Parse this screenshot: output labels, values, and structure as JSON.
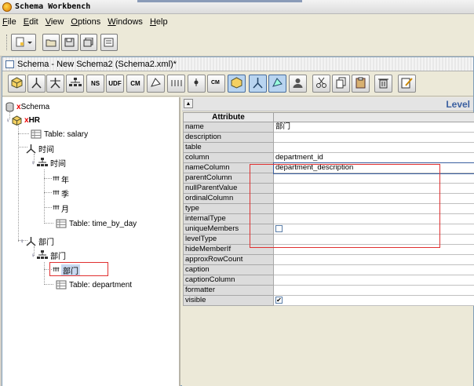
{
  "window": {
    "title": "Schema Workbench"
  },
  "menu": [
    {
      "label": "File",
      "key": "F"
    },
    {
      "label": "Edit",
      "key": "E"
    },
    {
      "label": "View",
      "key": "V"
    },
    {
      "label": "Options",
      "key": "O"
    },
    {
      "label": "Windows",
      "key": "W"
    },
    {
      "label": "Help",
      "key": "H"
    }
  ],
  "schema_window": {
    "title": "Schema - New Schema2 (Schema2.xml)*"
  },
  "schema_toolbar": [
    {
      "name": "add-cube-button",
      "icon": "cube-icon"
    },
    {
      "name": "add-dimension-button",
      "icon": "dimension-icon"
    },
    {
      "name": "add-dimension-usage-button",
      "icon": "dimension-usage-icon"
    },
    {
      "name": "add-hierarchy-button",
      "icon": "hierarchy-icon"
    },
    {
      "name": "add-named-set-button",
      "label": "NS"
    },
    {
      "name": "add-udf-button",
      "label": "UDF"
    },
    {
      "name": "add-calculated-member-button",
      "label": "CM"
    },
    {
      "name": "add-measure-button",
      "icon": "measure-icon"
    },
    {
      "name": "add-level-button",
      "icon": "level-icon"
    },
    {
      "name": "add-property-button",
      "icon": "property-icon"
    },
    {
      "name": "add-calc-member-prop-button",
      "icon": "calc-icon"
    },
    {
      "name": "add-virtual-cube-button",
      "icon": "virtual-cube-icon"
    },
    {
      "name": "add-virtual-dimension-button",
      "icon": "virtual-dimension-icon"
    },
    {
      "name": "add-virtual-measure-button",
      "icon": "virtual-measure-icon"
    },
    {
      "name": "add-role-button",
      "icon": "role-icon"
    },
    {
      "name": "cut-button",
      "icon": "scissors-icon"
    },
    {
      "name": "copy-button",
      "icon": "copy-icon"
    },
    {
      "name": "paste-button",
      "icon": "clipboard-icon"
    },
    {
      "name": "delete-button",
      "icon": "trash-icon"
    },
    {
      "name": "edit-mode-button",
      "icon": "pencil-icon"
    }
  ],
  "tree": {
    "root": "Schema",
    "cube": "HR",
    "cube_table": "Table: salary",
    "dim_time": "时间",
    "hier_time": "时间",
    "time_levels": [
      "年",
      "季",
      "月"
    ],
    "time_table": "Table: time_by_day",
    "dim_dept": "部门",
    "hier_dept": "部门",
    "dept_level": "部门",
    "dept_table": "Table: department"
  },
  "attributes": {
    "level_label": "Level",
    "header": "Attribute",
    "rows": [
      {
        "name": "name",
        "value": "部门"
      },
      {
        "name": "description",
        "value": ""
      },
      {
        "name": "table",
        "value": ""
      },
      {
        "name": "column",
        "value": "department_id"
      },
      {
        "name": "nameColumn",
        "value": "department_description"
      },
      {
        "name": "parentColumn",
        "value": ""
      },
      {
        "name": "nullParentValue",
        "value": ""
      },
      {
        "name": "ordinalColumn",
        "value": ""
      },
      {
        "name": "type",
        "value": ""
      },
      {
        "name": "internalType",
        "value": ""
      },
      {
        "name": "uniqueMembers",
        "value": "",
        "checkbox": false
      },
      {
        "name": "levelType",
        "value": ""
      },
      {
        "name": "hideMemberIf",
        "value": ""
      },
      {
        "name": "approxRowCount",
        "value": ""
      },
      {
        "name": "caption",
        "value": ""
      },
      {
        "name": "captionColumn",
        "value": ""
      },
      {
        "name": "formatter",
        "value": ""
      },
      {
        "name": "visible",
        "value": "",
        "checkbox": true
      }
    ]
  },
  "colors": {
    "accent": "#3a5fa0",
    "highlight": "#e03030"
  }
}
